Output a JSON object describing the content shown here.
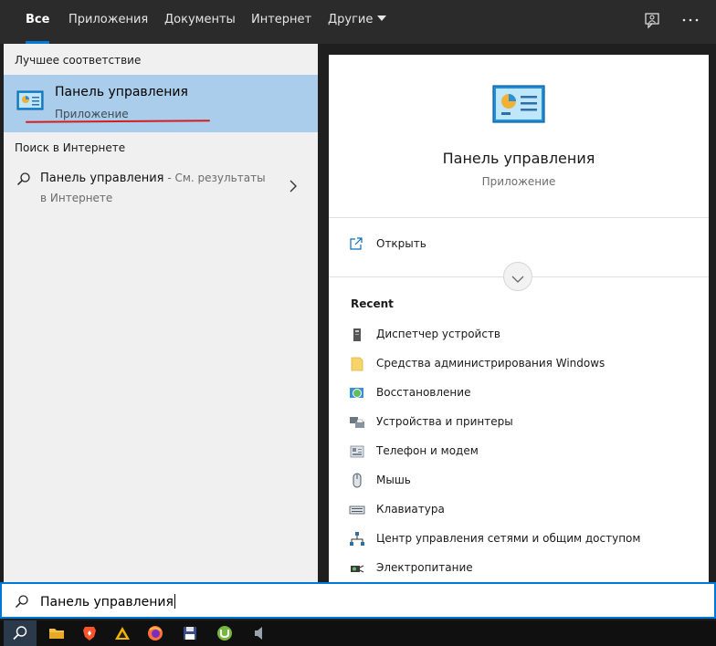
{
  "tabs": [
    {
      "label": "Все",
      "active": true
    },
    {
      "label": "Приложения",
      "active": false
    },
    {
      "label": "Документы",
      "active": false
    },
    {
      "label": "Интернет",
      "active": false
    },
    {
      "label": "Другие",
      "active": false
    }
  ],
  "top_icons": [
    "feedback-icon",
    "more-icon"
  ],
  "left": {
    "best_match_title": "Лучшее соответствие",
    "best_match": {
      "title": "Панель управления",
      "subtitle": "Приложение",
      "icon": "control-panel-icon"
    },
    "web_title": "Поиск в Интернете",
    "web_item": {
      "label": "Панель управления",
      "hint": " - См. результаты",
      "hint_cont": "в Интернете"
    }
  },
  "right": {
    "title": "Панель управления",
    "subtitle": "Приложение",
    "open_label": "Открыть",
    "recent_title": "Recent",
    "recent": [
      {
        "label": "Диспетчер устройств",
        "icon": "device-manager-icon"
      },
      {
        "label": "Средства администрирования Windows",
        "icon": "folder-icon"
      },
      {
        "label": "Восстановление",
        "icon": "recovery-icon"
      },
      {
        "label": "Устройства и принтеры",
        "icon": "printer-icon"
      },
      {
        "label": "Телефон и модем",
        "icon": "phone-modem-icon"
      },
      {
        "label": "Мышь",
        "icon": "mouse-icon"
      },
      {
        "label": "Клавиатура",
        "icon": "keyboard-icon"
      },
      {
        "label": "Центр управления сетями и общим доступом",
        "icon": "network-icon"
      },
      {
        "label": "Электропитание",
        "icon": "power-options-icon"
      }
    ]
  },
  "search": {
    "value": "Панель управления"
  },
  "taskbar": [
    "search-icon",
    "file-explorer-icon",
    "brave-icon",
    "aimp-icon",
    "firefox-icon",
    "save-app-icon",
    "utorrent-icon",
    "sound-icon"
  ],
  "colors": {
    "accent": "#0078d7",
    "selection": "#a9cdea",
    "underline": "#d51d1d"
  }
}
